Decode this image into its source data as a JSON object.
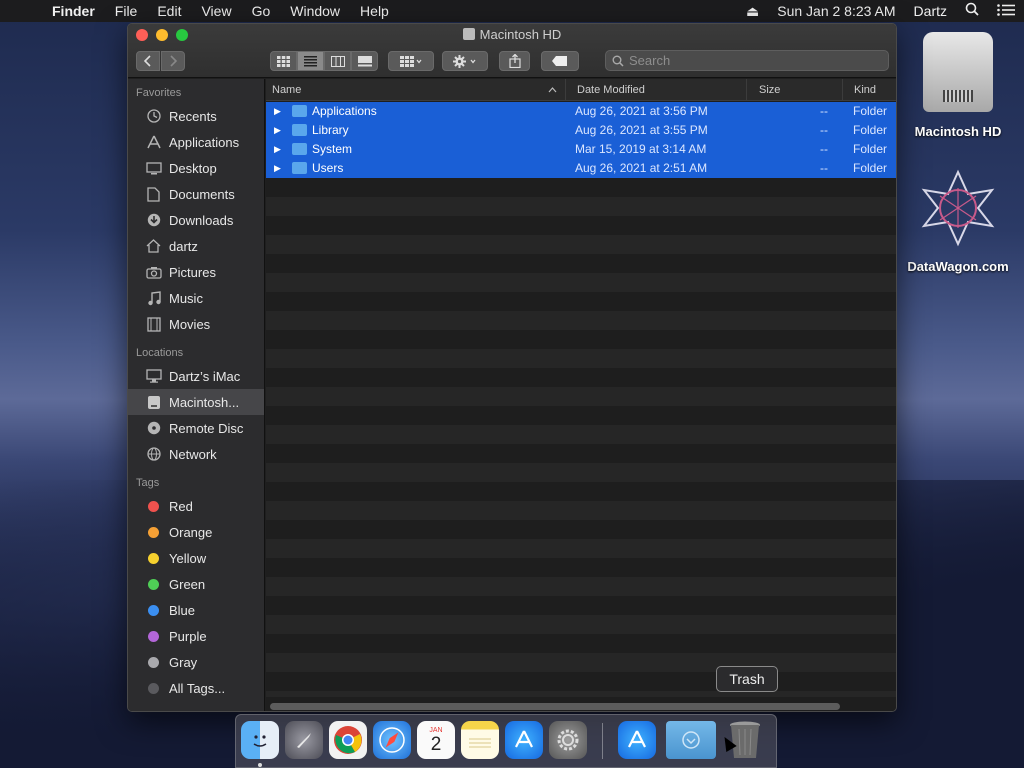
{
  "menubar": {
    "app_name": "Finder",
    "menus": [
      "File",
      "Edit",
      "View",
      "Go",
      "Window",
      "Help"
    ],
    "datetime": "Sun Jan 2  8:23 AM",
    "user": "Dartz"
  },
  "window": {
    "title": "Macintosh HD",
    "search_placeholder": "Search"
  },
  "sidebar": {
    "favorites_label": "Favorites",
    "favorites": [
      {
        "label": "Recents",
        "icon": "clock-icon"
      },
      {
        "label": "Applications",
        "icon": "applications-icon"
      },
      {
        "label": "Desktop",
        "icon": "desktop-icon"
      },
      {
        "label": "Documents",
        "icon": "documents-icon"
      },
      {
        "label": "Downloads",
        "icon": "downloads-icon"
      },
      {
        "label": "dartz",
        "icon": "home-icon"
      },
      {
        "label": "Pictures",
        "icon": "camera-icon"
      },
      {
        "label": "Music",
        "icon": "music-note-icon"
      },
      {
        "label": "Movies",
        "icon": "film-icon"
      }
    ],
    "locations_label": "Locations",
    "locations": [
      {
        "label": "Dartz’s iMac",
        "icon": "computer-icon"
      },
      {
        "label": "Macintosh...",
        "icon": "hard-drive-icon"
      },
      {
        "label": "Remote Disc",
        "icon": "disc-icon"
      },
      {
        "label": "Network",
        "icon": "globe-icon"
      }
    ],
    "tags_label": "Tags",
    "tags": [
      {
        "label": "Red",
        "color": "#f0524e"
      },
      {
        "label": "Orange",
        "color": "#f5a035"
      },
      {
        "label": "Yellow",
        "color": "#f6d12e"
      },
      {
        "label": "Green",
        "color": "#4fce56"
      },
      {
        "label": "Blue",
        "color": "#3b8ff1"
      },
      {
        "label": "Purple",
        "color": "#b366d8"
      },
      {
        "label": "Gray",
        "color": "#a9a9ad"
      },
      {
        "label": "All Tags...",
        "color": "#5a5a5e"
      }
    ]
  },
  "columns": {
    "name": "Name",
    "date": "Date Modified",
    "size": "Size",
    "kind": "Kind"
  },
  "files": [
    {
      "name": "Applications",
      "date": "Aug 26, 2021 at 3:56 PM",
      "size": "--",
      "kind": "Folder"
    },
    {
      "name": "Library",
      "date": "Aug 26, 2021 at 3:55 PM",
      "size": "--",
      "kind": "Folder"
    },
    {
      "name": "System",
      "date": "Mar 15, 2019 at 3:14 AM",
      "size": "--",
      "kind": "Folder"
    },
    {
      "name": "Users",
      "date": "Aug 26, 2021 at 2:51 AM",
      "size": "--",
      "kind": "Folder"
    }
  ],
  "desktop": {
    "hd_label": "Macintosh HD",
    "dw_label": "DataWagon.com"
  },
  "dock": {
    "tooltip": "Trash",
    "calendar_month": "JAN",
    "calendar_day": "2",
    "accent_color": "#1a5fd6"
  }
}
